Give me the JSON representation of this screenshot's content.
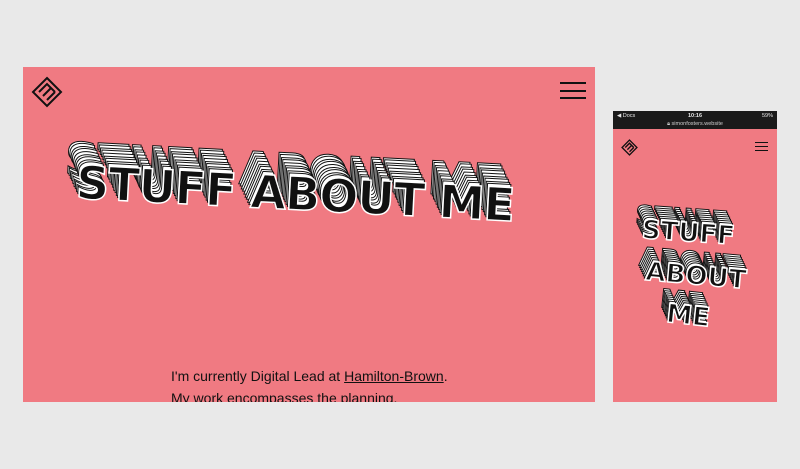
{
  "desktop": {
    "hero_title": "STUFF ABOUT ME",
    "intro": {
      "prefix": "I'm currently Digital Lead at ",
      "link": "Hamilton-Brown",
      "suffix": ".",
      "line2": "My work encompasses the planning,"
    }
  },
  "mobile": {
    "status": {
      "back": "◀ Docs",
      "time": "10:16",
      "battery": "59%",
      "url": "simonfosters.website"
    },
    "hero_lines": [
      "STUFF",
      "ABOUT",
      "ME"
    ]
  },
  "colors": {
    "background": "#e9e9e9",
    "page": "#f07a82",
    "ink": "#111111"
  },
  "icons": {
    "logo": "logo-mark-icon",
    "menu": "hamburger-menu-icon",
    "lock": "lock-icon"
  }
}
